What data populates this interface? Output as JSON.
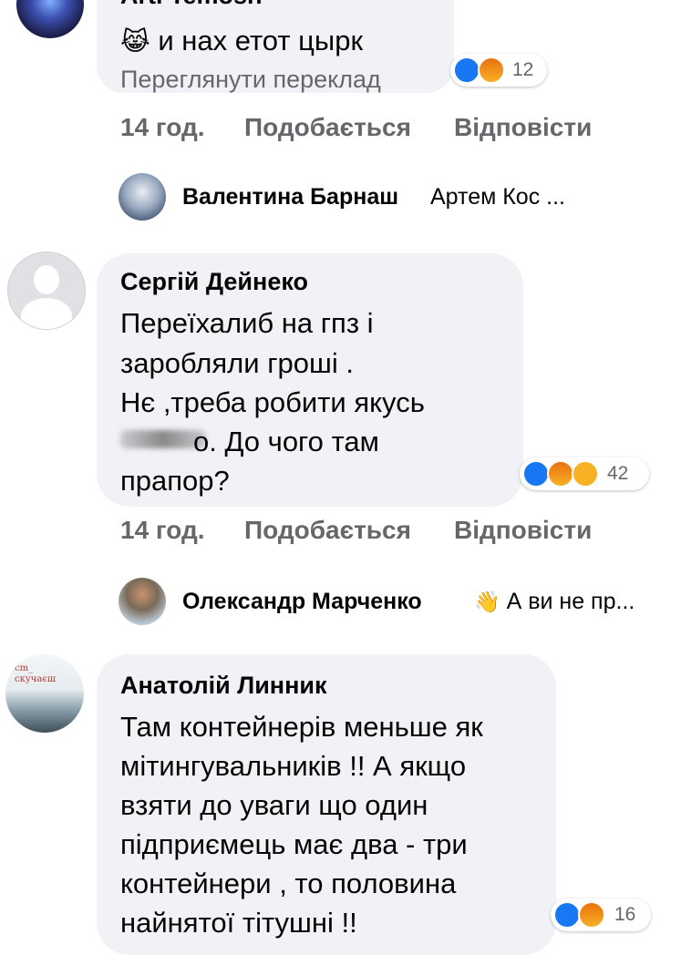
{
  "comments": [
    {
      "author": "Arti Temosh",
      "emoji": "😹",
      "text": "и нах етот цырк",
      "translate_link": "Переглянути переклад",
      "reaction_count": "12",
      "time": "14 год.",
      "like_label": "Подобається",
      "reply_label": "Відповісти"
    },
    {
      "author": "Сергій Дейнеко",
      "lines": [
        "Переїхалиб на гпз і",
        "заробляли гроші .",
        "Нє ,треба робити  якусь",
        "о. До чого там",
        "прапор?"
      ],
      "reaction_count": "42",
      "time": "14 год.",
      "like_label": "Подобається",
      "reply_label": "Відповісти"
    },
    {
      "author": "Анатолій Линник",
      "lines": [
        "Там контейнерів меньше як",
        "мітингувальників !! А якщо",
        "взяти до уваги що один",
        "підприємець має два - три",
        "контейнери , то половина",
        "найнятої тітушні !!"
      ],
      "reaction_count": "16",
      "avatar_caption": "cm_ скучаєш"
    }
  ],
  "replies": [
    {
      "author": "Валентина Барнаш",
      "preview": "Артем Кос ..."
    },
    {
      "author": "Олександр Марченко",
      "icon": "👋",
      "preview": "А ви не пр..."
    }
  ]
}
